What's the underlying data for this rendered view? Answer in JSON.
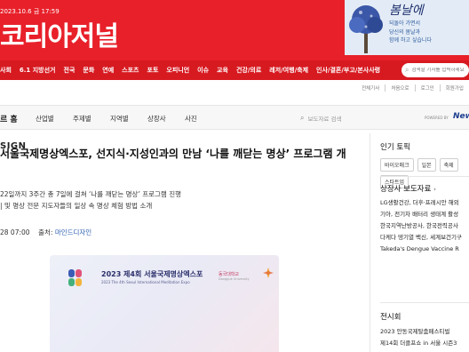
{
  "header": {
    "date": "2023.10.6 금 17:59",
    "logo": "코리아저널",
    "ad": {
      "headline": "봄날에",
      "lines": [
        "되돌아 가면서",
        "당신의 봄날과",
        "함께 하고 싶습니다"
      ]
    }
  },
  "nav": {
    "items": [
      "사회",
      "6.1 지방선거",
      "전국",
      "문화",
      "연예",
      "스포츠",
      "포토",
      "오피니언",
      "이슈",
      "교육",
      "건강/의료",
      "레저/여행/축제",
      "인사/결혼/부고/본사사령"
    ],
    "search_placeholder": "검색할 기사를 입력하세요"
  },
  "util_links": [
    "전체기사",
    "처음으로",
    "로그인",
    "회원가입"
  ],
  "subnav": {
    "home": "르 홈",
    "items": [
      "산업별",
      "주제별",
      "지역별",
      "상장사",
      "사진"
    ],
    "search_placeholder": "보도자료 검색",
    "powered_by": "POWERED BY",
    "newswire": "New"
  },
  "article": {
    "category": "SIGN",
    "title": "서울국제명상엑스포, 선지식·지성인과의 만남 ‘나를 깨닫는 명상’ 프로그램 개",
    "summary": [
      "22일까지 3주간 총 7일에 걸쳐 ‘나를 깨닫는 명상’ 프로그램 진행",
      "| 및 명상 전문 지도자들의 일상 속 명상 체험 방법 소개"
    ],
    "meta_time": "28 07:00",
    "meta_source_label": "출처:",
    "meta_source": "마인드디자인",
    "hero": {
      "title": "2023 제4회 서울국제명상엑스포",
      "subtitle": "2023 The 4th Seoul International Meditation Expo",
      "university": "동국대학교",
      "university_en": "Dongguk University"
    }
  },
  "sidebar": {
    "popular_heading": "인기 토픽",
    "tags": [
      "바이오매크",
      "일본",
      "축제",
      "스타트업"
    ],
    "press_heading": "상장사 보도자료",
    "press_items": [
      "LG생활건강, 더후·프레시안 해외",
      "기아, 전기차 배터리 생태계 활성",
      "한국지역난방공사, 한국전력공사",
      "다케다 뎅기열 백신, 세계보건기구",
      "Takeda's Dengue Vaccine R"
    ],
    "exhibit_heading": "전시회",
    "exhibit_items": [
      "2023 안동국제탈춤페스티벌",
      "제14회 더클프쇼 in 서울 시즌3"
    ]
  },
  "colors": {
    "brand_red": "#e8202a",
    "nav_red": "#d71920",
    "link_blue": "#2a5db0"
  }
}
